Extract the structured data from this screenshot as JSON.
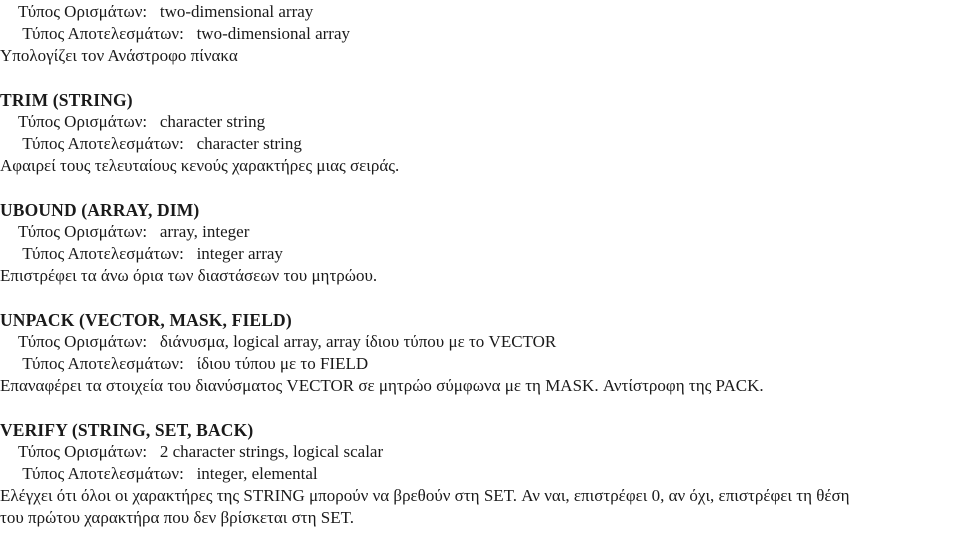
{
  "document": {
    "language": "el",
    "background_color": "#ffffff",
    "text_color": "#1a1a1a",
    "labels": {
      "arguments": "Τύπος Ορισμάτων:",
      "results": "Τύπος Αποτελεσμάτων:"
    },
    "entries": [
      {
        "heading": "",
        "arguments_line": " Τύπος Ορισμάτων:   two-dimensional array",
        "results_line": "  Τύπος Αποτελεσμάτων:   two-dimensional array",
        "description_lines": [
          "Υπολογίζει τον Ανάστροφο πίνακα"
        ]
      },
      {
        "heading": "TRIM (STRING)",
        "arguments_line": " Τύπος Ορισμάτων:   character string",
        "results_line": "  Τύπος Αποτελεσμάτων:   character string",
        "description_lines": [
          "Αφαιρεί τους τελευταίους κενούς χαρακτήρες μιας σειράς."
        ]
      },
      {
        "heading": "UBOUND (ARRAY, DIM)",
        "arguments_line": " Τύπος Ορισμάτων:   array, integer",
        "results_line": "  Τύπος Αποτελεσμάτων:   integer array",
        "description_lines": [
          "Επιστρέφει τα άνω όρια των διαστάσεων του μητρώου."
        ]
      },
      {
        "heading": "UNPACK (VECTOR, MASK, FIELD)",
        "arguments_line": " Τύπος Ορισμάτων:   διάνυσμα, logical array, array ίδιου τύπου με το VECTOR",
        "results_line": "  Τύπος Αποτελεσμάτων:   ίδιου τύπου με το FIELD",
        "description_lines": [
          "Επαναφέρει τα στοιχεία του διανύσματος VECTOR σε μητρώο σύμφωνα με τη MASK. Αντίστροφη της PACK."
        ]
      },
      {
        "heading": "VERIFY (STRING, SET, BACK)",
        "arguments_line": " Τύπος Ορισμάτων:   2 character strings, logical scalar",
        "results_line": "  Τύπος Αποτελεσμάτων:   integer, elemental",
        "description_lines": [
          "Ελέγχει ότι όλοι οι χαρακτήρες της STRING μπορούν να βρεθούν στη SET. Αν ναι, επιστρέφει 0, αν όχι, επιστρέφει τη θέση",
          "του πρώτου χαρακτήρα που δεν βρίσκεται στη SET."
        ]
      }
    ]
  }
}
